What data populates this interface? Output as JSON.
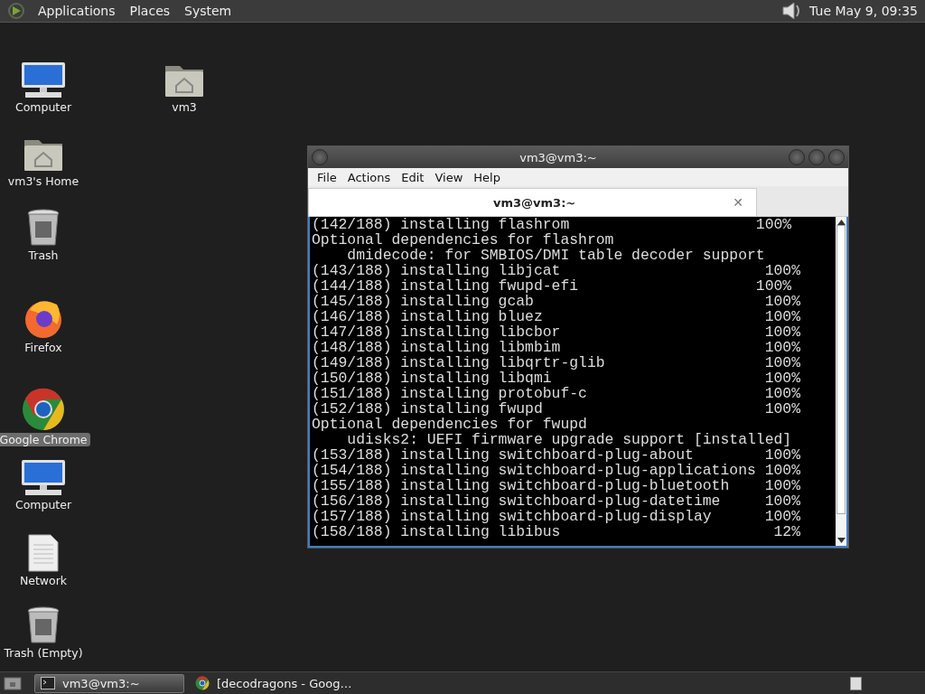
{
  "top_panel": {
    "menus": [
      "Applications",
      "Places",
      "System"
    ],
    "clock": "Tue May  9, 09:35"
  },
  "desktop_icons": [
    {
      "kind": "computer",
      "label": "Computer",
      "selected": false
    },
    {
      "kind": "home",
      "label": "vm3's Home",
      "selected": false
    },
    {
      "kind": "trash",
      "label": "Trash",
      "selected": false
    },
    {
      "kind": "firefox",
      "label": "Firefox",
      "selected": false
    },
    {
      "kind": "chrome",
      "label": "Google Chrome",
      "selected": true
    },
    {
      "kind": "computer",
      "label": "Computer",
      "selected": false
    },
    {
      "kind": "document",
      "label": "Network",
      "selected": false
    },
    {
      "kind": "trash",
      "label": "Trash (Empty)",
      "selected": false
    },
    {
      "kind": "home",
      "label": "vm3",
      "selected": false
    }
  ],
  "terminal_window": {
    "title": "vm3@vm3:~",
    "menus": [
      "File",
      "Actions",
      "Edit",
      "View",
      "Help"
    ],
    "tabs": [
      {
        "label": "vm3@vm3:~",
        "selected": true,
        "close": "✕"
      }
    ],
    "lines": [
      "(142/188) installing flashrom                     100%",
      "Optional dependencies for flashrom",
      "    dmidecode: for SMBIOS/DMI table decoder support",
      "(143/188) installing libjcat                       100%",
      "(144/188) installing fwupd-efi                    100%",
      "(145/188) installing gcab                          100%",
      "(146/188) installing bluez                         100%",
      "(147/188) installing libcbor                       100%",
      "(148/188) installing libmbim                       100%",
      "(149/188) installing libqrtr-glib                  100%",
      "(150/188) installing libqmi                        100%",
      "(151/188) installing protobuf-c                    100%",
      "(152/188) installing fwupd                         100%",
      "Optional dependencies for fwupd",
      "    udisks2: UEFI firmware upgrade support [installed]",
      "(153/188) installing switchboard-plug-about        100%",
      "(154/188) installing switchboard-plug-applications 100%",
      "(155/188) installing switchboard-plug-bluetooth    100%",
      "(156/188) installing switchboard-plug-datetime     100%",
      "(157/188) installing switchboard-plug-display      100%",
      "(158/188) installing libibus                        12%"
    ]
  },
  "taskbar": {
    "tasks": [
      {
        "kind": "terminal",
        "label": "vm3@vm3:~",
        "selected": true
      },
      {
        "kind": "chrome",
        "label": "[decodragons - Goog…",
        "selected": false
      }
    ]
  }
}
